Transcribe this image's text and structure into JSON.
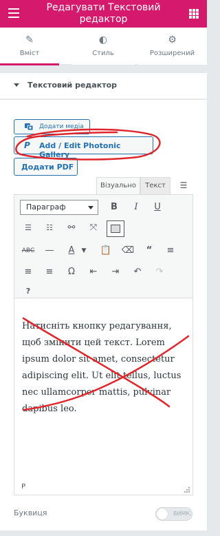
{
  "header": {
    "title": "Редагувати Текстовий редактор"
  },
  "tabs": [
    {
      "label": "Вміст",
      "icon": "pencil-icon"
    },
    {
      "label": "Стиль",
      "icon": "contrast-icon"
    },
    {
      "label": "Розширений",
      "icon": "gear-icon"
    }
  ],
  "section": {
    "title": "Текстовий редактор"
  },
  "buttons": {
    "media": "Додати медіа",
    "photonic": "Add / Edit Photonic Gallery",
    "photonic_icon": "P",
    "pdf": "Додати PDF"
  },
  "editor_tabs": {
    "visual": "Візуально",
    "text": "Текст"
  },
  "toolbar": {
    "format_value": "Параграф"
  },
  "content": {
    "text": "Натисніть кнопку редагування, щоб змінити цей текст. Lorem ipsum dolor sit amet, consectetur adipiscing elit. Ut elit tellus, luctus nec ullamcorper mattis, pulvinar dapibus leo."
  },
  "statusbar": {
    "path": "P"
  },
  "drop_cap": {
    "label": "Буквиця",
    "toggle_text": "ВИМК."
  },
  "colors": {
    "brand": "#d5196d",
    "link": "#2271b1",
    "annotation": "#e0262b"
  }
}
